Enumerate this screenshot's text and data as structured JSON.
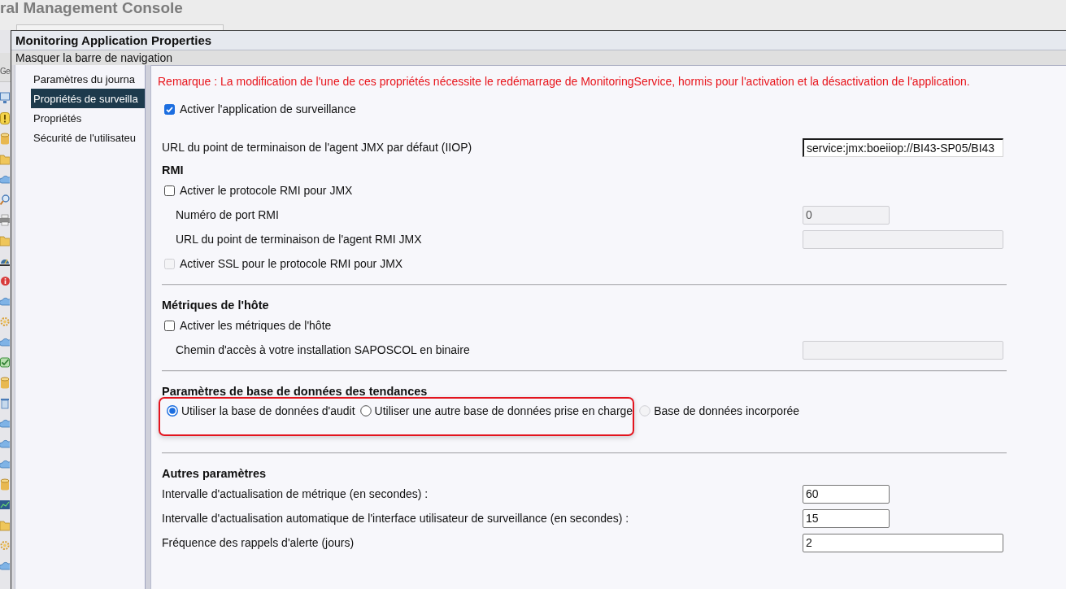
{
  "background": {
    "title": "ral Management Console",
    "tab_label": "Ge"
  },
  "dialog": {
    "title": "Monitoring Application Properties",
    "nav_toggle": "Masquer la barre de navigation",
    "nav_items": [
      {
        "label": "Paramètres du journa",
        "selected": false
      },
      {
        "label": "Propriétés de surveilla",
        "selected": true
      },
      {
        "label": "Propriétés",
        "selected": false
      },
      {
        "label": "Sécurité de l'utilisateu",
        "selected": false
      }
    ],
    "notice": "Remarque : La modification de l'une de ces propriétés nécessite le redémarrage de MonitoringService, hormis pour l'activation et la désactivation de l'application.",
    "sections": [
      {
        "divider_above": false,
        "rows": [
          {
            "kind": "checkbox",
            "label": "Activer l'application de surveillance",
            "checked": true,
            "disabled": false
          },
          {
            "kind": "field",
            "label": "URL du point de terminaison de l'agent JMX par défaut (IIOP)",
            "value": "service:jmx:boeiiop://BI43-SP05/BI43",
            "wide": true,
            "disabled": false,
            "focused": true
          }
        ]
      },
      {
        "divider_above": false,
        "heading": "RMI",
        "rows": [
          {
            "kind": "checkbox",
            "label": "Activer le protocole RMI pour JMX",
            "checked": false,
            "disabled": false,
            "children": [
              {
                "kind": "field",
                "label": "Numéro de port RMI",
                "value": "0",
                "wide": false,
                "disabled": true,
                "focused": false
              },
              {
                "kind": "field",
                "label": "URL du point de terminaison de l'agent RMI JMX",
                "wide": true,
                "disabled": true,
                "focused": false
              }
            ]
          },
          {
            "kind": "checkbox",
            "label": "Activer SSL pour le protocole RMI pour JMX",
            "checked": false,
            "disabled": true
          }
        ]
      },
      {
        "divider_above": true,
        "heading": "Métriques de l'hôte",
        "rows": [
          {
            "kind": "checkbox",
            "label": "Activer les métriques de l'hôte",
            "checked": false,
            "disabled": false,
            "children": [
              {
                "kind": "field",
                "label": "Chemin d'accès à votre installation SAPOSCOL en binaire",
                "wide": true,
                "disabled": true,
                "focused": false
              }
            ]
          }
        ]
      },
      {
        "divider_above": true,
        "heading": "Paramètres de base de données des tendances",
        "rows": [
          {
            "kind": "radios",
            "options": [
              {
                "label": "Utiliser la base de données d'audit",
                "selected": true,
                "disabled": false,
                "highlighted": true
              },
              {
                "label": "Utiliser une autre base de données prise en charge",
                "selected": false,
                "disabled": false,
                "highlighted": true
              },
              {
                "label": "Base de données incorporée",
                "selected": false,
                "disabled": true,
                "highlighted": false
              }
            ]
          }
        ]
      },
      {
        "divider_above": true,
        "heading": "Autres paramètres",
        "rows": [
          {
            "kind": "field",
            "label": "Intervalle d'actualisation de métrique (en secondes) :",
            "value": "60",
            "wide": false,
            "disabled": false,
            "focused": false
          },
          {
            "kind": "field",
            "label": "Intervalle d'actualisation automatique de l'interface utilisateur de surveillance (en secondes) :",
            "value": "15",
            "wide": false,
            "disabled": false,
            "focused": false
          },
          {
            "kind": "field",
            "label": "Fréquence des rappels d'alerte (jours)",
            "value": "2",
            "wide": true,
            "disabled": false,
            "focused": false
          }
        ]
      }
    ]
  }
}
